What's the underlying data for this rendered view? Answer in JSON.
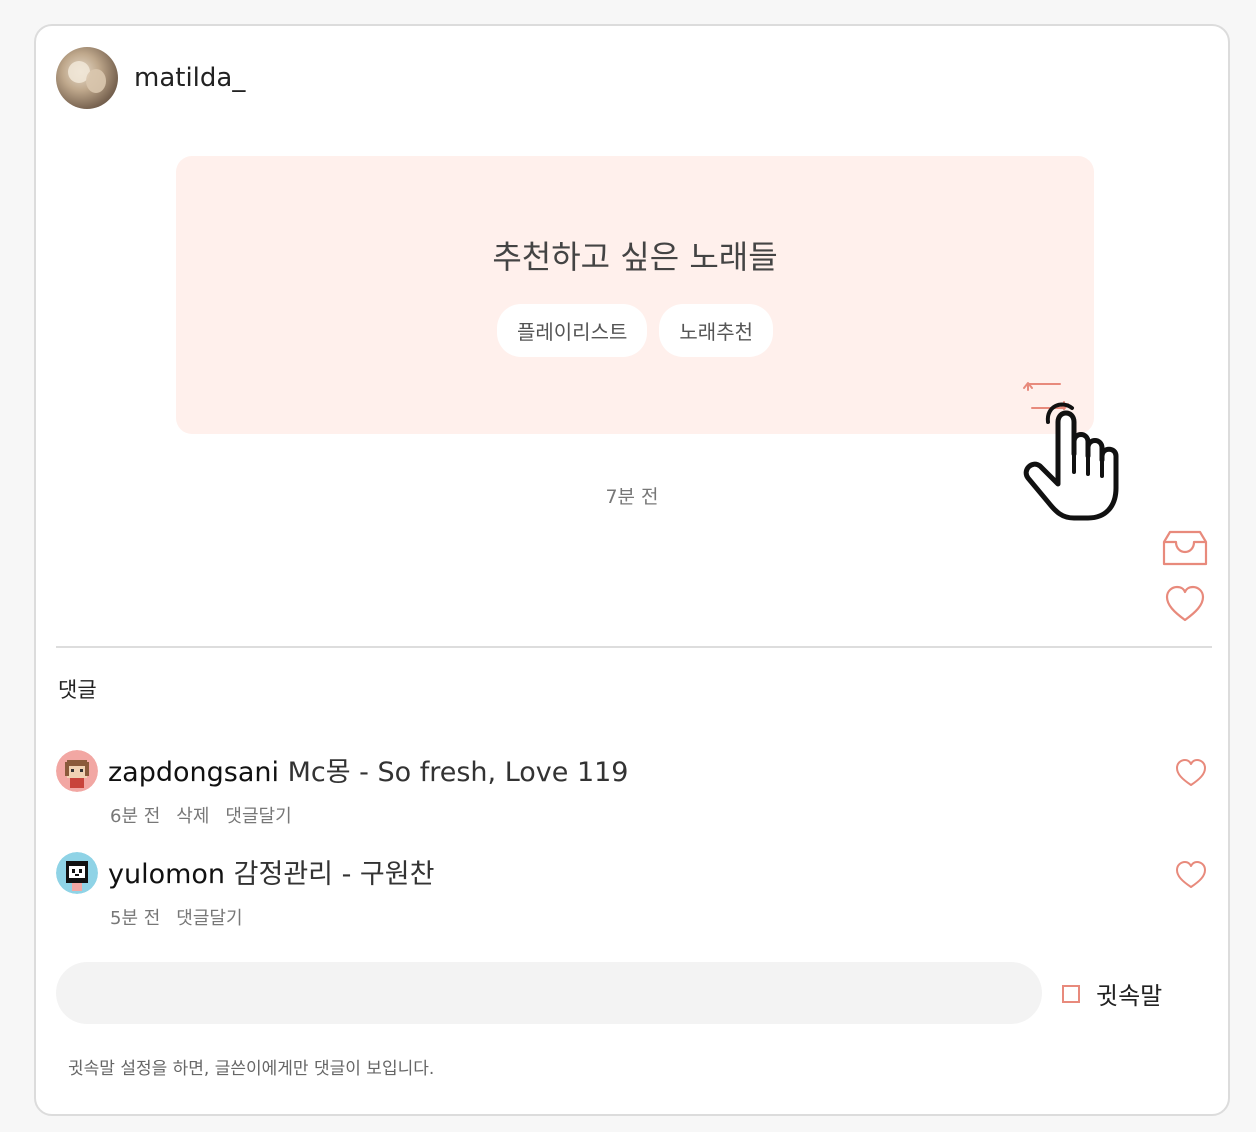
{
  "post": {
    "author": "matilda_",
    "title": "추천하고 싶은 노래들",
    "tags": [
      "플레이리스트",
      "노래추천"
    ],
    "time": "7분 전"
  },
  "comments_section": {
    "heading": "댓글",
    "items": [
      {
        "user": "zapdongsani",
        "text": "Mc몽 - So fresh, Love 119",
        "time": "6분 전",
        "actions": [
          "삭제",
          "댓글달기"
        ]
      },
      {
        "user": "yulomon",
        "text": "감정관리 - 구원찬",
        "time": "5분 전",
        "actions": [
          "댓글달기"
        ]
      }
    ]
  },
  "composer": {
    "value": "",
    "placeholder": "",
    "secret_label": "귓속말",
    "secret_checked": false,
    "notice": "귓속말 설정을 하면, 글쓴이에게만 댓글이 보입니다."
  },
  "icons": {
    "repost": "repost-icon",
    "save": "inbox-tray-icon",
    "like": "heart-icon",
    "cursor": "hand-pointer-icon"
  },
  "colors": {
    "accent": "#e88a7c",
    "banner_bg": "#fff0ec"
  }
}
